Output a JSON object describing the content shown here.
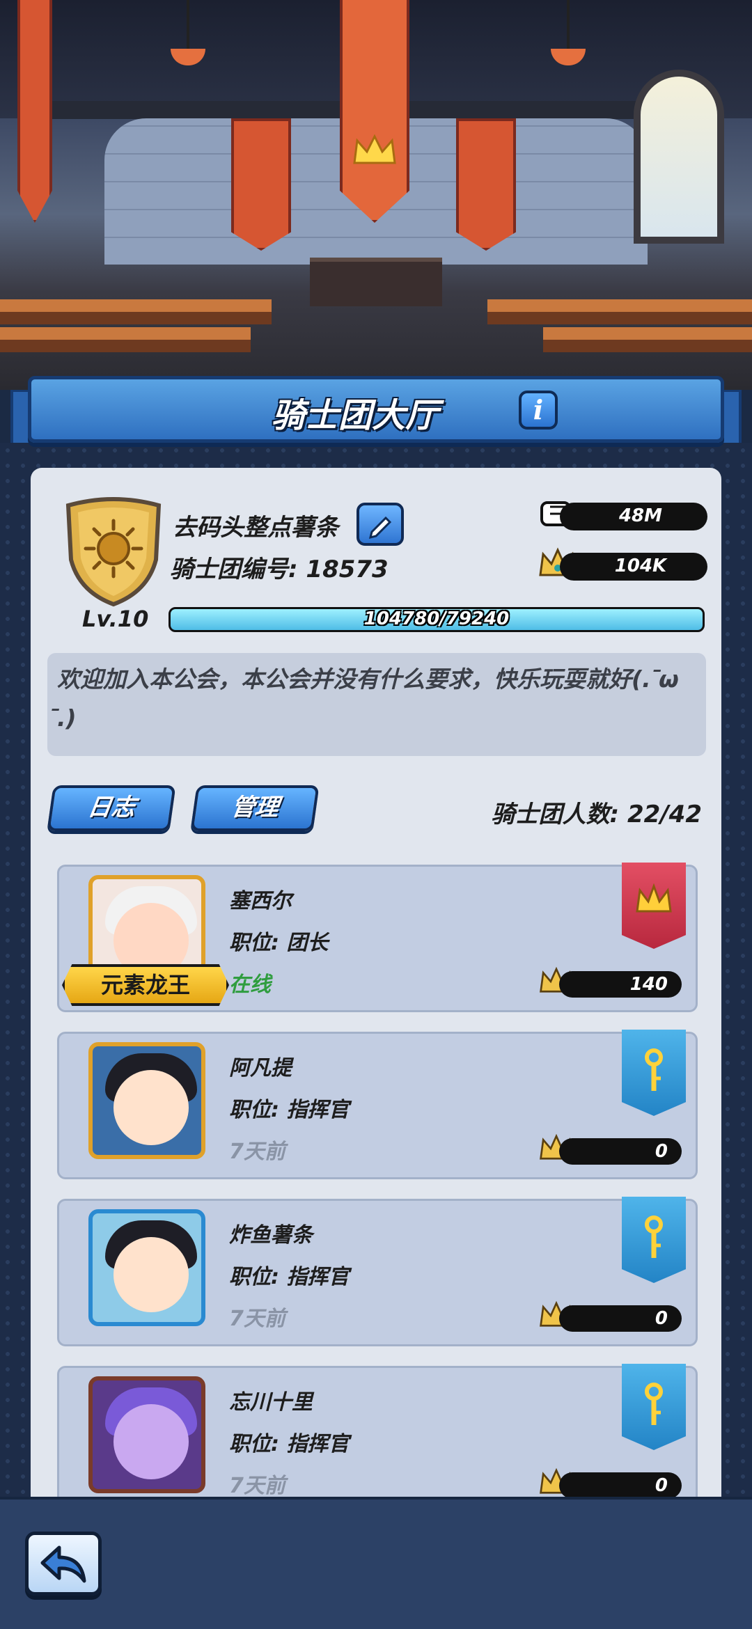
{
  "header": {
    "title": "骑士团大厅",
    "info_icon": "info-icon"
  },
  "guild": {
    "name": "去码头整点薯条",
    "id_label": "骑士团编号: 18573",
    "level": "Lv.10",
    "stat_power": "48M",
    "stat_crown": "104K",
    "xp_text": "104780/79240",
    "xp_fraction": 1.0,
    "notice": "欢迎加入本公会，本公会并没有什么要求，快乐玩耍就好(. ̄ω ̄.)"
  },
  "actions": {
    "log_label": "日志",
    "manage_label": "管理",
    "member_count": "骑士团人数: 22/42"
  },
  "members": [
    {
      "name": "塞西尔",
      "role": "职位: 团长",
      "status": "在线",
      "online": true,
      "title_badge": "元素龙王",
      "power": "140",
      "flag": "red",
      "frame": "gold"
    },
    {
      "name": "阿凡提",
      "role": "职位: 指挥官",
      "status": "7天前",
      "online": false,
      "power": "0",
      "flag": "blue",
      "frame": "gold"
    },
    {
      "name": "炸鱼薯条",
      "role": "职位: 指挥官",
      "status": "7天前",
      "online": false,
      "power": "0",
      "flag": "blue",
      "frame": "blue"
    },
    {
      "name": "忘川十里",
      "role": "职位: 指挥官",
      "status": "7天前",
      "online": false,
      "power": "0",
      "flag": "blue",
      "frame": "purple"
    }
  ],
  "colors": {
    "accent_blue": "#2f75d2",
    "online_green": "#2f9d3f",
    "leader_flag": "#d03a52",
    "officer_flag": "#2f95d6"
  }
}
